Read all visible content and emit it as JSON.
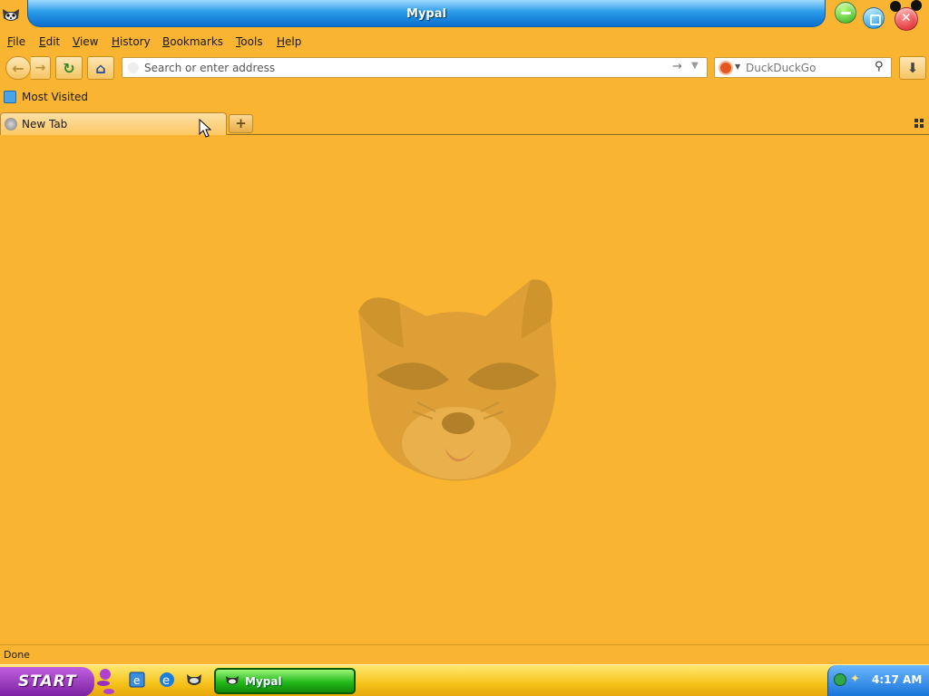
{
  "window": {
    "title": "Mypal"
  },
  "menubar": {
    "items": [
      {
        "label": "File",
        "accel": "F",
        "rest": "ile"
      },
      {
        "label": "Edit",
        "accel": "E",
        "rest": "dit"
      },
      {
        "label": "View",
        "accel": "V",
        "rest": "iew"
      },
      {
        "label": "History",
        "accel": "H",
        "rest": "istory"
      },
      {
        "label": "Bookmarks",
        "accel": "B",
        "rest": "ookmarks"
      },
      {
        "label": "Tools",
        "accel": "T",
        "rest": "ools"
      },
      {
        "label": "Help",
        "accel": "H",
        "rest": "elp"
      }
    ]
  },
  "navbar": {
    "url_placeholder": "Search or enter address",
    "url_value": "",
    "search_placeholder": "DuckDuckGo",
    "search_engine": "DuckDuckGo"
  },
  "bookmarks": {
    "most_visited": "Most Visited"
  },
  "tabs": [
    {
      "label": "New Tab",
      "selected": true
    }
  ],
  "statusbar": {
    "text": "Done"
  },
  "taskbar": {
    "start_label": "START",
    "task_label": "Mypal",
    "clock": "4:17 AM"
  },
  "colors": {
    "theme_bg": "#f9b432",
    "titlebar_blue": "#0a6fcf",
    "start_purple": "#7a1fa0",
    "task_green": "#24b91a"
  },
  "icons": {
    "app": "raccoon-icon",
    "back": "back-arrow-icon",
    "forward": "forward-arrow-icon",
    "reload": "reload-icon",
    "home": "home-icon",
    "go": "go-arrow-icon",
    "search": "magnifier-icon",
    "download": "download-icon"
  }
}
